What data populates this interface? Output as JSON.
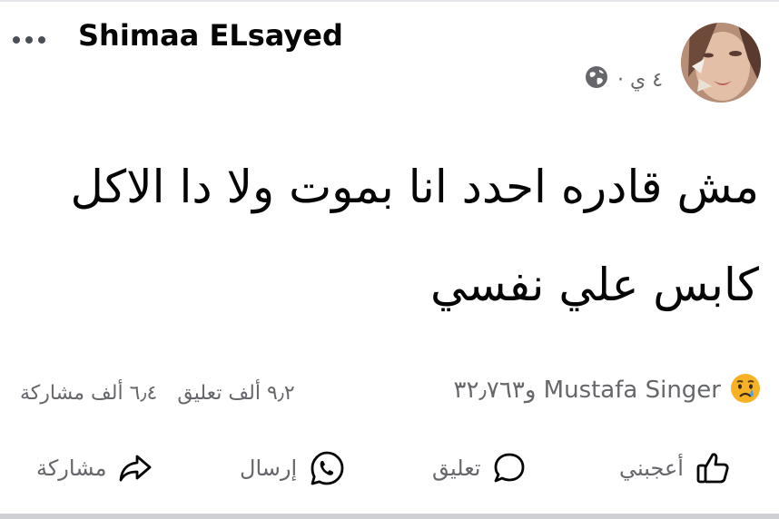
{
  "post": {
    "author": "Shimaa ELsayed",
    "time": "٤ ي ·",
    "audience_icon": "globe-icon",
    "text_lines": [
      "مش قادره احدد انا بموت ولا دا الاكل",
      "كابس علي نفسي"
    ]
  },
  "reactions": {
    "icon": "sad-reaction-icon",
    "names": "Mustafa Singer و٣٢٫٧٦٣"
  },
  "counts": {
    "comments": "٩٫٢ ألف تعليق",
    "shares": "٦٫٤ ألف مشاركة"
  },
  "actions": {
    "like": "أعجبني",
    "comment": "تعليق",
    "send": "إرسال",
    "share": "مشاركة"
  },
  "colors": {
    "text": "#050505",
    "secondary": "#65676b",
    "divider": "#ced0d4"
  }
}
